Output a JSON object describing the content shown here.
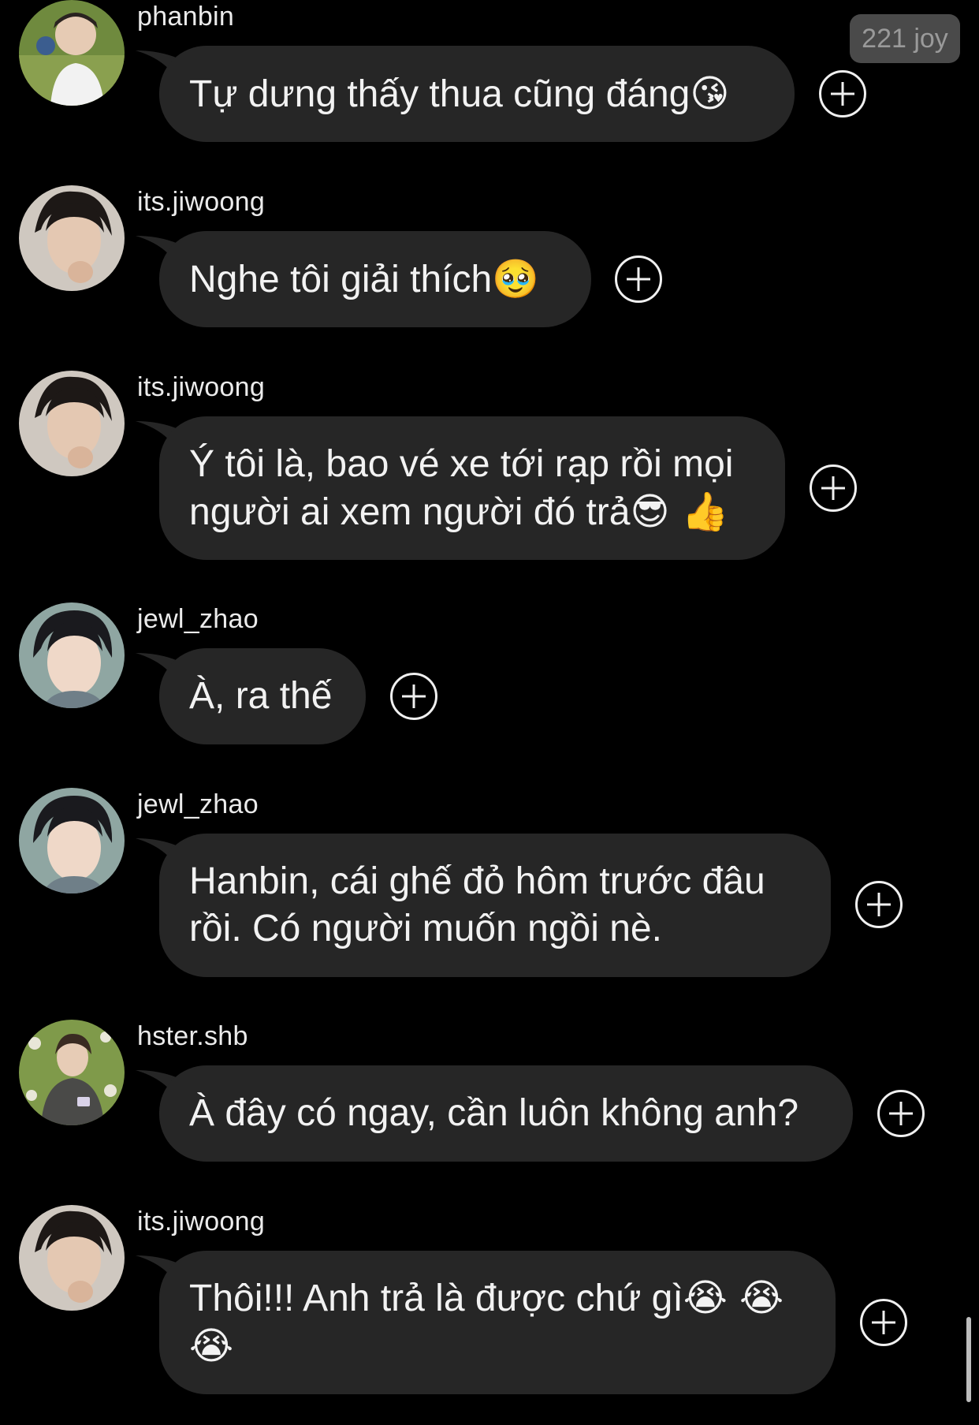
{
  "timestamp": "221 joy",
  "colors": {
    "background": "#000000",
    "bubble": "#262626",
    "text": "#f2f2f2",
    "username": "#ebebeb"
  },
  "messages": [
    {
      "username": "phanbin",
      "text": "Tự dưng thấy thua cũng đáng",
      "emoji": "😘",
      "avatar_icon": "avatar-phanbin",
      "add_icon": "plus-circle-icon"
    },
    {
      "username": "its.jiwoong",
      "text": "Nghe tôi giải thích",
      "emoji": "🥹",
      "avatar_icon": "avatar-its-jiwoong",
      "add_icon": "plus-circle-icon"
    },
    {
      "username": "its.jiwoong",
      "text_line1": "Ý tôi là, bao vé xe tới rạp rồi mọi",
      "text_line2": "người ai xem người đó trả",
      "emoji": "😎 👍",
      "avatar_icon": "avatar-its-jiwoong",
      "add_icon": "plus-circle-icon"
    },
    {
      "username": "jewl_zhao",
      "text": "À, ra thế",
      "avatar_icon": "avatar-jewl-zhao",
      "add_icon": "plus-circle-icon"
    },
    {
      "username": "jewl_zhao",
      "text_line1": "Hanbin, cái ghế đỏ hôm trước đâu",
      "text_line2": "rồi. Có người muốn ngồi nè.",
      "avatar_icon": "avatar-jewl-zhao",
      "add_icon": "plus-circle-icon"
    },
    {
      "username": "hster.shb",
      "text": "À đây có ngay, cần luôn không anh?",
      "avatar_icon": "avatar-hster-shb",
      "add_icon": "plus-circle-icon"
    },
    {
      "username": "its.jiwoong",
      "text_line1": "Thôi!!! Anh trả là được chứ gì",
      "emoji_line1": "😭 😭",
      "emoji_line2": "😭",
      "avatar_icon": "avatar-its-jiwoong",
      "add_icon": "plus-circle-icon"
    }
  ]
}
